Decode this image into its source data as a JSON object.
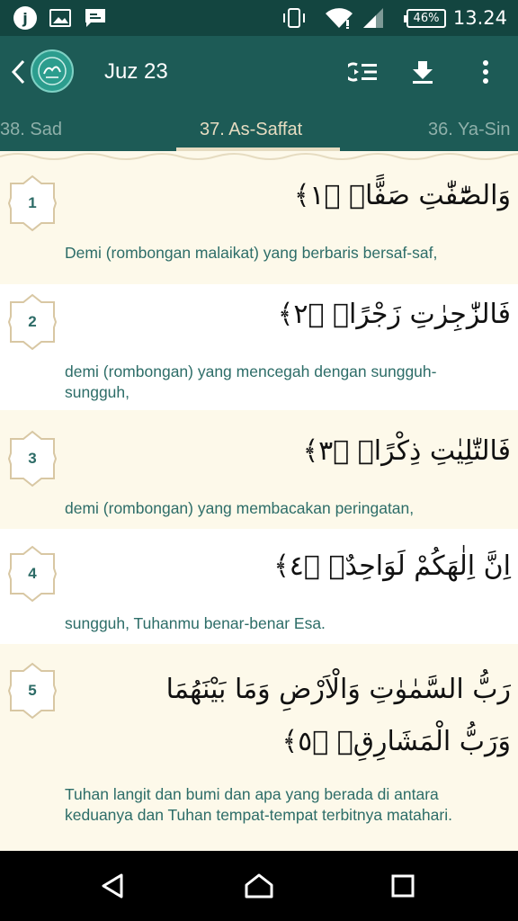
{
  "status_bar": {
    "time": "13.24",
    "battery": "46%",
    "icons": [
      "quran-app-notification-icon",
      "image-notification-icon",
      "message-notification-icon",
      "vibrate-icon",
      "wifi-icon",
      "signal-icon",
      "battery-icon"
    ]
  },
  "app_bar": {
    "title": "Juz 23",
    "icons": [
      "back-arrow-icon",
      "quran-logo-icon",
      "list-indent-icon",
      "download-icon",
      "more-vert-icon"
    ]
  },
  "tabs": [
    {
      "label": "38. Sad",
      "active": false
    },
    {
      "label": "37. As-Saffat",
      "active": true
    },
    {
      "label": "36. Ya-Sin",
      "active": false
    }
  ],
  "verses": [
    {
      "number": "1",
      "arabic": "وَالصّٰٓفّٰتِ صَفًّاۙ ﴿١﴾",
      "translation": "Demi (rombongan malaikat) yang berbaris bersaf-saf,"
    },
    {
      "number": "2",
      "arabic": "فَالزّٰجِرٰتِ زَجْرًاۙ ﴿٢﴾",
      "translation": "demi (rombongan) yang mencegah dengan sungguh-sungguh,"
    },
    {
      "number": "3",
      "arabic": "فَالتّٰلِيٰتِ ذِكْرًاۙ ﴿٣﴾",
      "translation": "demi (rombongan) yang membacakan peringatan,"
    },
    {
      "number": "4",
      "arabic": "اِنَّ اِلٰهَكُمْ لَوَاحِدٌۗ ﴿٤﴾",
      "translation": "sungguh, Tuhanmu benar-benar Esa."
    },
    {
      "number": "5",
      "arabic": "رَبُّ السَّمٰوٰتِ وَالْاَرْضِ وَمَا بَيْنَهُمَا وَرَبُّ الْمَشَارِقِۗ ﴿٥﴾",
      "translation": "Tuhan langit dan bumi dan apa yang berada di antara keduanya dan Tuhan tempat-tempat terbitnya matahari."
    }
  ],
  "nav_bar": {
    "icons": [
      "back-triangle-icon",
      "home-icon",
      "recents-icon"
    ]
  },
  "colors": {
    "status_bar": "#134540",
    "app_bar": "#1d5b56",
    "tab_inactive": "#8fb0aa",
    "tab_active": "#e6dcc1",
    "translation_text": "#2d6d68",
    "verse_bg_odd": "#fdf9ea",
    "verse_bg_even": "#ffffff"
  }
}
